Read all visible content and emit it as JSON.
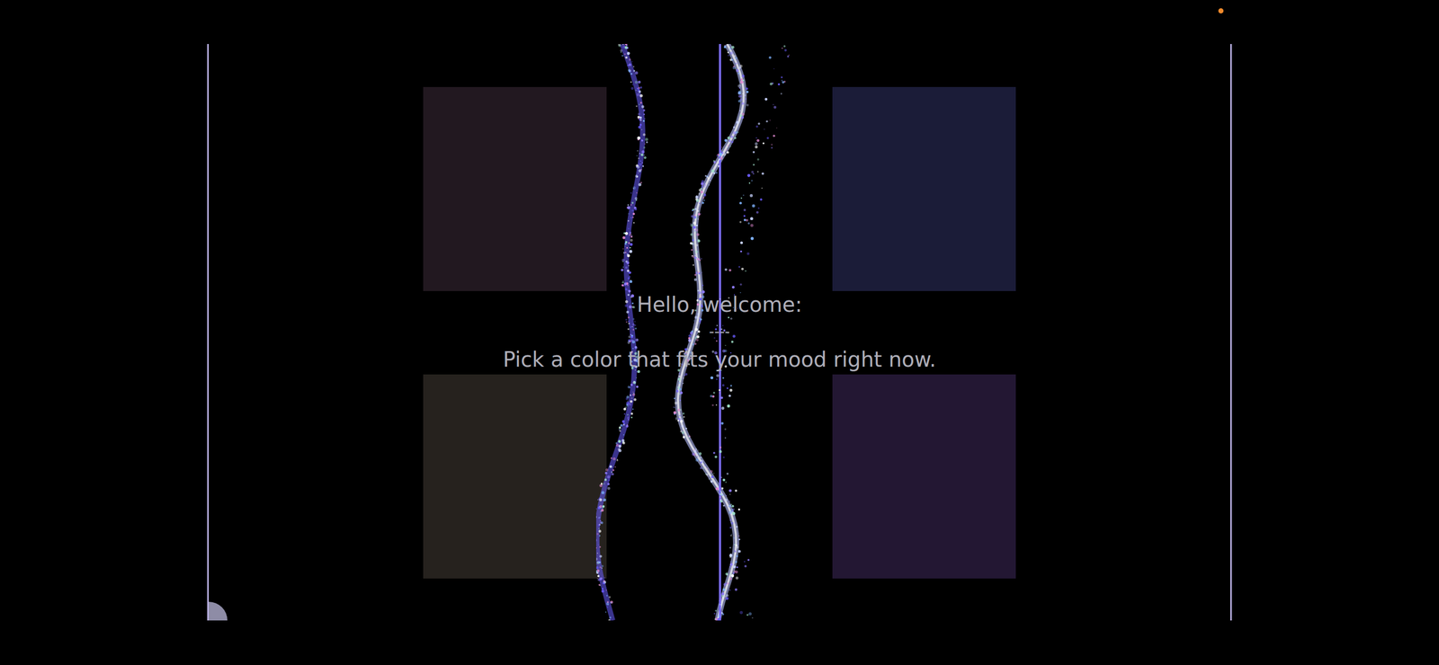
{
  "greeting": {
    "title": "Hello, welcome:",
    "divider": "----",
    "prompt": "Pick a color that fits your mood right now."
  },
  "swatches": [
    {
      "color": "#221820",
      "selected": false
    },
    {
      "color": "#1b1c38",
      "selected": false
    },
    {
      "color": "#26221e",
      "selected": false
    },
    {
      "color": "#231733",
      "selected": false
    }
  ]
}
